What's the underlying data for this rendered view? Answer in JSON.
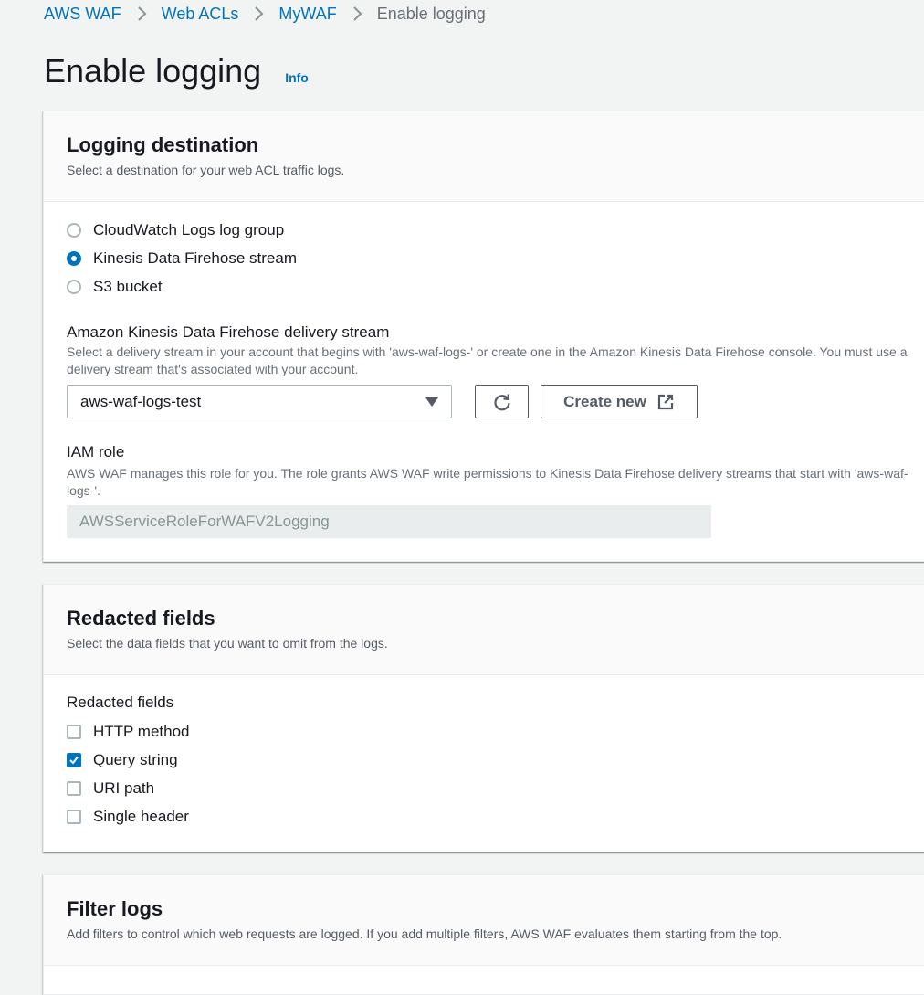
{
  "breadcrumb": {
    "items": [
      {
        "label": "AWS WAF"
      },
      {
        "label": "Web ACLs"
      },
      {
        "label": "MyWAF"
      }
    ],
    "current": "Enable logging"
  },
  "page": {
    "title": "Enable logging",
    "info_label": "Info"
  },
  "logging_destination": {
    "title": "Logging destination",
    "description": "Select a destination for your web ACL traffic logs.",
    "options": [
      {
        "label": "CloudWatch Logs log group",
        "selected": false
      },
      {
        "label": "Kinesis Data Firehose stream",
        "selected": true
      },
      {
        "label": "S3 bucket",
        "selected": false
      }
    ],
    "delivery_stream": {
      "label": "Amazon Kinesis Data Firehose delivery stream",
      "description": "Select a delivery stream in your account that begins with 'aws-waf-logs-' or create one in the Amazon Kinesis Data Firehose console. You must use a delivery stream that's associated with your account.",
      "selected_value": "aws-waf-logs-test",
      "refresh_icon": "refresh-icon",
      "create_new_label": "Create new",
      "external_icon": "external-link-icon"
    },
    "iam_role": {
      "label": "IAM role",
      "description": "AWS WAF manages this role for you. The role grants AWS WAF write permissions to Kinesis Data Firehose delivery streams that start with 'aws-waf-logs-'.",
      "value": "AWSServiceRoleForWAFV2Logging"
    }
  },
  "redacted_fields": {
    "title": "Redacted fields",
    "description": "Select the data fields that you want to omit from the logs.",
    "group_label": "Redacted fields",
    "options": [
      {
        "label": "HTTP method",
        "checked": false
      },
      {
        "label": "Query string",
        "checked": true
      },
      {
        "label": "URI path",
        "checked": false
      },
      {
        "label": "Single header",
        "checked": false
      }
    ]
  },
  "filter_logs": {
    "title": "Filter logs",
    "description": "Add filters to control which web requests are logged. If you add multiple filters, AWS WAF evaluates them starting from the top."
  },
  "colors": {
    "link": "#0073bb",
    "background": "#f2f3f3",
    "panel": "#ffffff",
    "text": "#16191f",
    "muted": "#687078"
  }
}
